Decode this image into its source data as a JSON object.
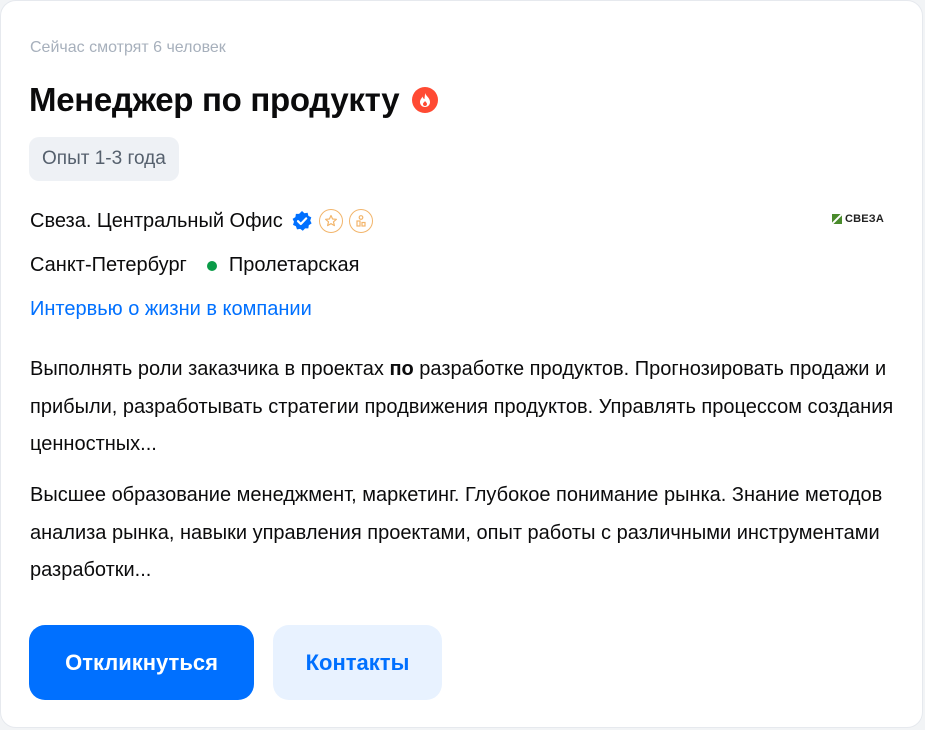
{
  "vacancy": {
    "watchers_text": "Сейчас смотрят 6 человек",
    "title": "Менеджер по продукту",
    "experience": "Опыт 1-3 года",
    "company": {
      "name": "Свеза. Центральный Офис",
      "logo_text": "СВЕЗА"
    },
    "location": {
      "city": "Санкт-Петербург",
      "metro": "Пролетарская",
      "metro_color": "#0a9b48"
    },
    "interview_link": "Интервью о жизни в компании",
    "description_1": {
      "before": "Выполнять роли заказчика в проектах ",
      "bold": "по",
      "after": " разработке продуктов. Прогнозировать продажи и прибыли, разработывать стратегии продвижения продуктов. Управлять процессом создания ценностных..."
    },
    "description_2": "Высшее образование менеджмент, маркетинг. Глубокое понимание рынка. Знание методов анализа рынка, навыки управления проектами, опыт работы с различными инструментами разработки...",
    "buttons": {
      "respond": "Откликнуться",
      "contacts": "Контакты"
    }
  },
  "icons": {
    "hot": "fire-icon",
    "verified": "verified-check-icon",
    "award": "star-badge-icon",
    "hr_brand": "people-badge-icon"
  },
  "colors": {
    "accent": "#0070ff",
    "hot": "#ff4a33",
    "badge_ring": "#f2b56b"
  }
}
